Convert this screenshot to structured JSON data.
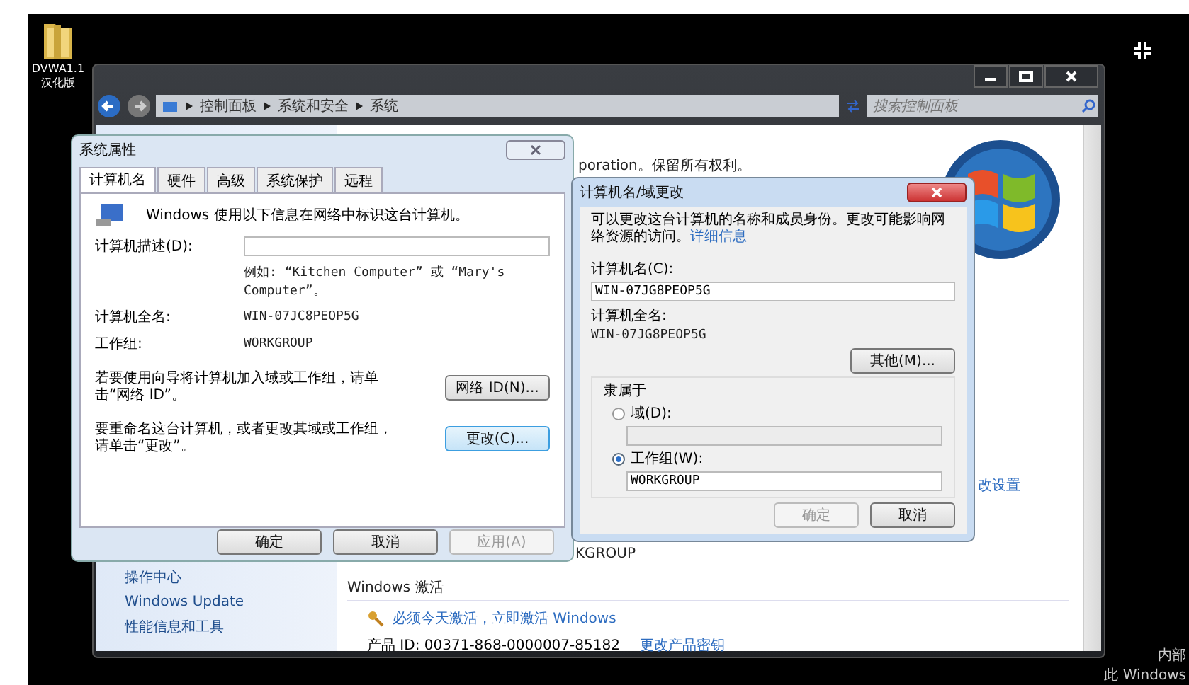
{
  "desktop": {
    "icon_lines": [
      "DVWA1.1",
      "汉化版"
    ],
    "corner_texts": [
      "内部",
      "此 Windows"
    ]
  },
  "explorer": {
    "breadcrumb": [
      "控制面板",
      "系统和安全",
      "系统"
    ],
    "search": {
      "placeholder": "搜索控制面板"
    },
    "sidebar_links": [
      "操作中心",
      "Windows Update",
      "性能信息和工具"
    ],
    "copyright_fragment": "poration。保留所有权利。",
    "workgroup_fragment": "KGROUP",
    "settings_link_fragment": "改设置",
    "activation": {
      "heading": "Windows 激活",
      "link": "必须今天激活，立即激活 Windows",
      "product_id": "产品 ID: 00371-868-0000007-85182",
      "change_key": "更改产品密钥"
    }
  },
  "system_properties": {
    "title": "系统属性",
    "tabs": [
      {
        "label": "计算机名",
        "selected": true
      },
      {
        "label": "硬件",
        "selected": false
      },
      {
        "label": "高级",
        "selected": false
      },
      {
        "label": "系统保护",
        "selected": false
      },
      {
        "label": "远程",
        "selected": false
      }
    ],
    "intro": "Windows 使用以下信息在网络中标识这台计算机。",
    "description_label": "计算机描述(D):",
    "description_hint": "例如: “Kitchen Computer” 或 “Mary's Computer”。",
    "full_name_label": "计算机全名:",
    "full_name": "WIN-07JC8PEOP5G",
    "workgroup_label": "工作组:",
    "workgroup": "WORKGROUP",
    "actions": [
      {
        "text": "若要使用向导将计算机加入域或工作组，请单击“网络 ID”。",
        "button": "网络 ID(N)...",
        "focused": false
      },
      {
        "text": "要重命名这台计算机，或者更改其域或工作组，请单击“更改”。",
        "button": "更改(C)...",
        "focused": true
      }
    ],
    "buttons": [
      {
        "label": "确定",
        "disabled": false
      },
      {
        "label": "取消",
        "disabled": false
      },
      {
        "label": "应用(A)",
        "disabled": true
      }
    ]
  },
  "name_dialog": {
    "title": "计算机名/域更改",
    "intro": "可以更改这台计算机的名称和成员身份。更改可能影响网络资源的访问。",
    "details_link": "详细信息",
    "name_label": "计算机名(C):",
    "name_value": "WIN-07JG8PEOP5G",
    "full_label": "计算机全名:",
    "full_value": "WIN-07JG8PEOP5G",
    "more_button": "其他(M)...",
    "member_of": "隶属于",
    "options": [
      {
        "label": "域(D):",
        "selected": false
      },
      {
        "label": "工作组(W):",
        "selected": true,
        "value": "WORKGROUP"
      }
    ],
    "buttons": [
      {
        "label": "确定",
        "disabled": true
      },
      {
        "label": "取消",
        "disabled": false
      }
    ]
  }
}
